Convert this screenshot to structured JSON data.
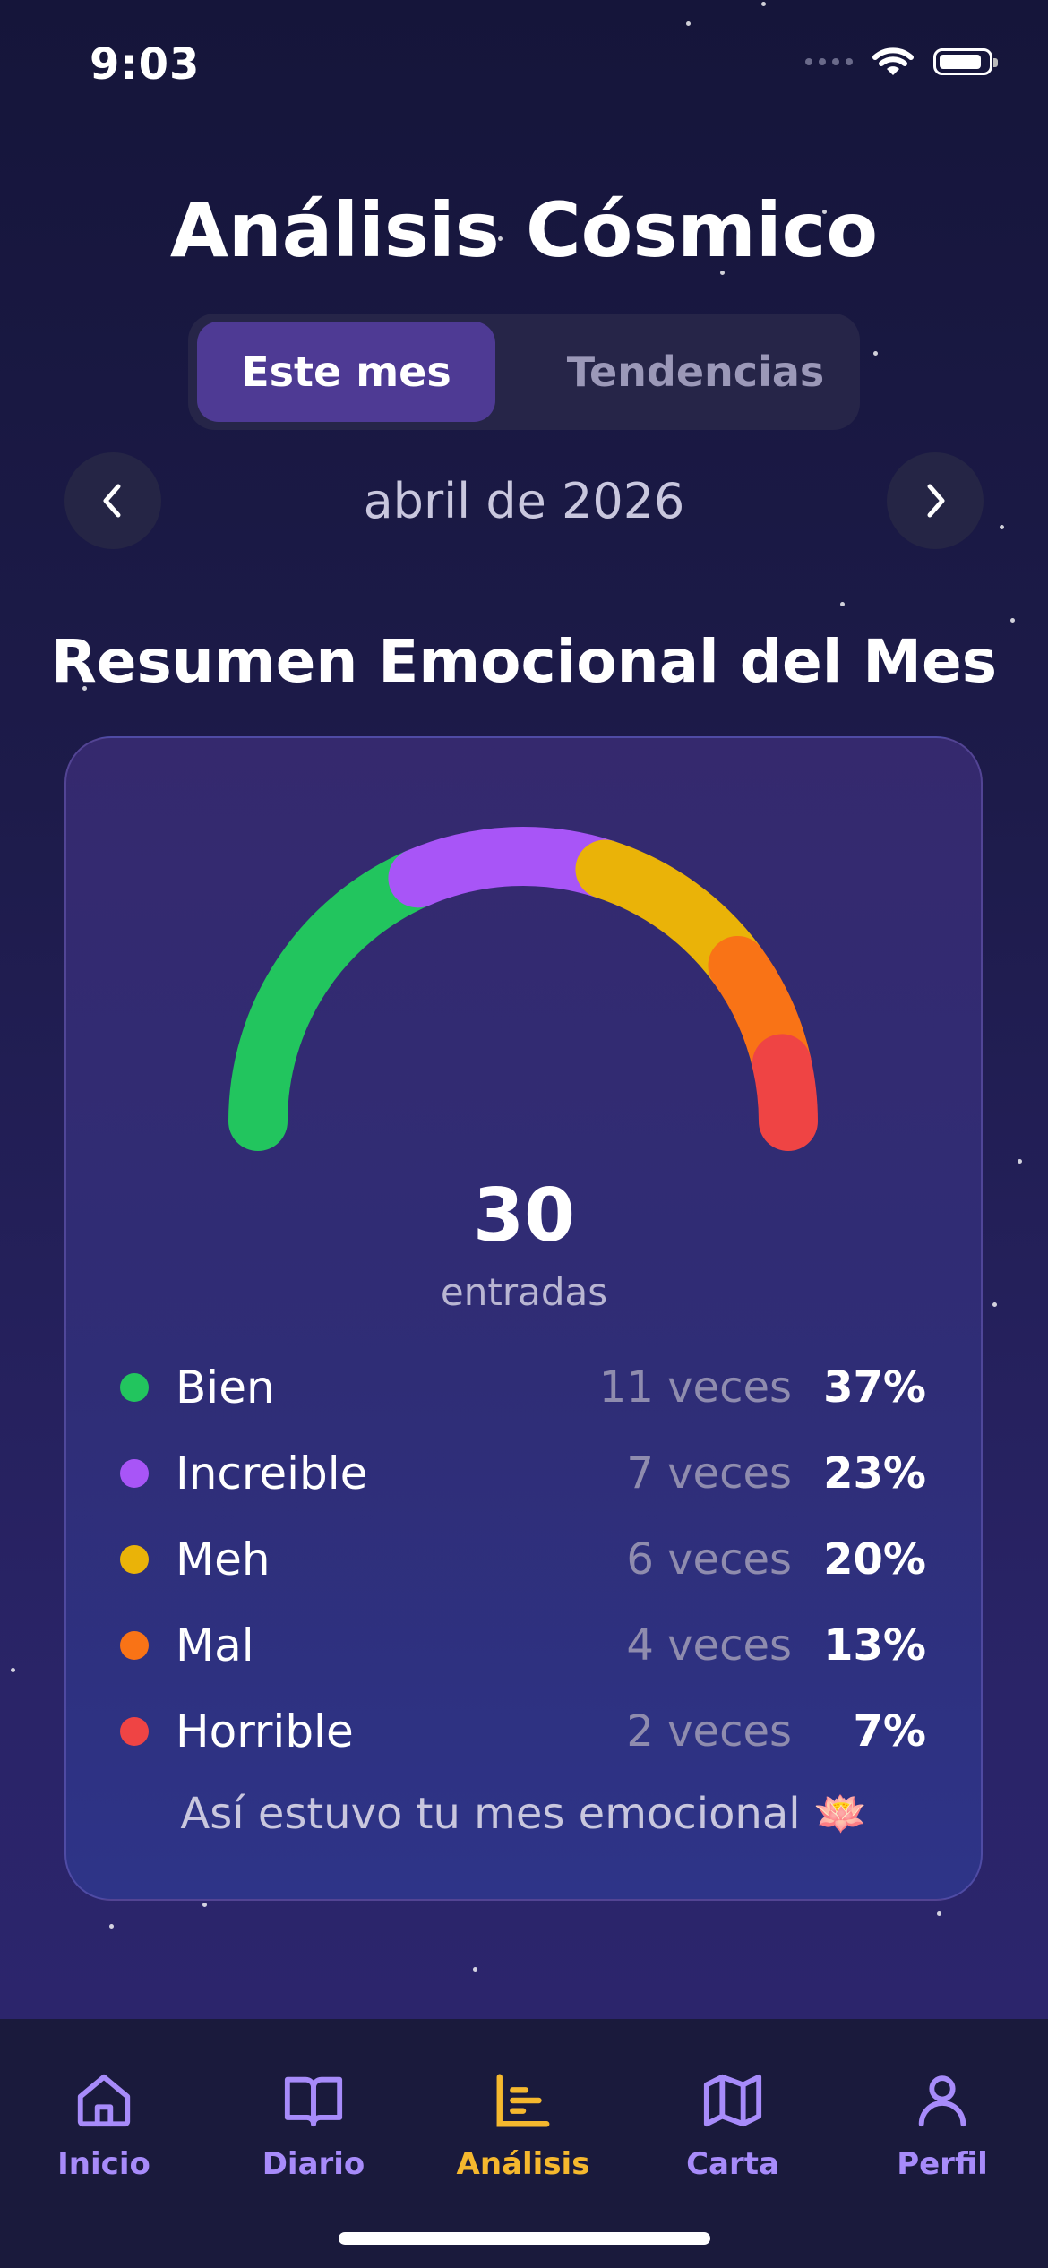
{
  "status_bar": {
    "time": "9:03"
  },
  "header": {
    "title": "Análisis Cósmico"
  },
  "segmented": {
    "tabs": [
      {
        "label": "Este mes"
      },
      {
        "label": "Tendencias"
      }
    ],
    "active_index": 0
  },
  "period": {
    "label": "abril de 2026"
  },
  "summary": {
    "title": "Resumen Emocional del Mes",
    "total": "30",
    "total_label": "entradas",
    "moods": [
      {
        "name": "Bien",
        "count": "11 veces",
        "percent": "37%",
        "share": 0.37,
        "color": "#22c55e"
      },
      {
        "name": "Increible",
        "count": "7 veces",
        "percent": "23%",
        "share": 0.23,
        "color": "#a855f7"
      },
      {
        "name": "Meh",
        "count": "6 veces",
        "percent": "20%",
        "share": 0.2,
        "color": "#eab308"
      },
      {
        "name": "Mal",
        "count": "4 veces",
        "percent": "13%",
        "share": 0.13,
        "color": "#f97316"
      },
      {
        "name": "Horrible",
        "count": "2 veces",
        "percent": "7%",
        "share": 0.07,
        "color": "#ef4444"
      }
    ],
    "caption": "Así estuvo tu mes emocional 🪷"
  },
  "tabbar": {
    "items": [
      {
        "label": "Inicio",
        "icon": "home-icon"
      },
      {
        "label": "Diario",
        "icon": "book-icon"
      },
      {
        "label": "Análisis",
        "icon": "chart-icon",
        "active": true
      },
      {
        "label": "Carta",
        "icon": "map-icon"
      },
      {
        "label": "Perfil",
        "icon": "user-icon"
      }
    ],
    "active_color": "#f5b82e",
    "inactive_color": "#a78bfa"
  }
}
